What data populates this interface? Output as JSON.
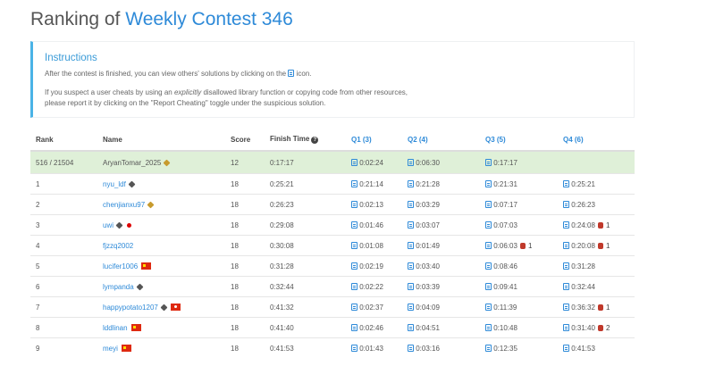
{
  "page": {
    "title_prefix": "Ranking of",
    "contest_name": "Weekly Contest 346"
  },
  "instructions": {
    "title": "Instructions",
    "p1_before": "After the contest is finished, you can view others' solutions by clicking on the",
    "p1_after": "icon.",
    "p2_a": "If you suspect a user cheats by using an ",
    "p2_em": "explicitly",
    "p2_b": " disallowed library function or copying code from other resources,",
    "p2_c": "please report it by clicking on the \"Report Cheating\" toggle under the suspicious solution."
  },
  "table": {
    "headers": {
      "rank": "Rank",
      "name": "Name",
      "score": "Score",
      "finish": "Finish Time",
      "finish_icon": "?",
      "q1": "Q1 (3)",
      "q2": "Q2 (4)",
      "q3": "Q3 (5)",
      "q4": "Q4 (6)"
    },
    "my_row": {
      "rank": "516 / 21504",
      "name": "AryanTomar_2025",
      "score": "12",
      "finish": "0:17:17",
      "q1": "0:02:24",
      "q2": "0:06:30",
      "q3": "0:17:17"
    },
    "rows": [
      {
        "rank": "1",
        "name": "nyu_ldf",
        "score": "18",
        "finish": "0:25:21",
        "q1": "0:21:14",
        "q2": "0:21:28",
        "q3": "0:21:31",
        "q4": "0:25:21"
      },
      {
        "rank": "2",
        "name": "chenjianxu97",
        "score": "18",
        "finish": "0:26:23",
        "q1": "0:02:13",
        "q2": "0:03:29",
        "q3": "0:07:17",
        "q4": "0:26:23"
      },
      {
        "rank": "3",
        "name": "uwi",
        "score": "18",
        "finish": "0:29:08",
        "q1": "0:01:46",
        "q2": "0:03:07",
        "q3": "0:07:03",
        "q4": "0:24:08",
        "q4_penalty": "1"
      },
      {
        "rank": "4",
        "name": "fjzzq2002",
        "score": "18",
        "finish": "0:30:08",
        "q1": "0:01:08",
        "q2": "0:01:49",
        "q3": "0:06:03",
        "q3_penalty": "1",
        "q4": "0:20:08",
        "q4_penalty": "1"
      },
      {
        "rank": "5",
        "name": "lucifer1006",
        "score": "18",
        "finish": "0:31:28",
        "q1": "0:02:19",
        "q2": "0:03:40",
        "q3": "0:08:46",
        "q4": "0:31:28"
      },
      {
        "rank": "6",
        "name": "lympanda",
        "score": "18",
        "finish": "0:32:44",
        "q1": "0:02:22",
        "q2": "0:03:39",
        "q3": "0:09:41",
        "q4": "0:32:44"
      },
      {
        "rank": "7",
        "name": "happypotato1207",
        "score": "18",
        "finish": "0:41:32",
        "q1": "0:02:37",
        "q2": "0:04:09",
        "q3": "0:11:39",
        "q4": "0:36:32",
        "q4_penalty": "1"
      },
      {
        "rank": "8",
        "name": "lddlinan",
        "score": "18",
        "finish": "0:41:40",
        "q1": "0:02:46",
        "q2": "0:04:51",
        "q3": "0:10:48",
        "q4": "0:31:40",
        "q4_penalty": "2"
      },
      {
        "rank": "9",
        "name": "meyi",
        "score": "18",
        "finish": "0:41:53",
        "q1": "0:01:43",
        "q2": "0:03:16",
        "q3": "0:12:35",
        "q4": "0:41:53"
      }
    ]
  }
}
